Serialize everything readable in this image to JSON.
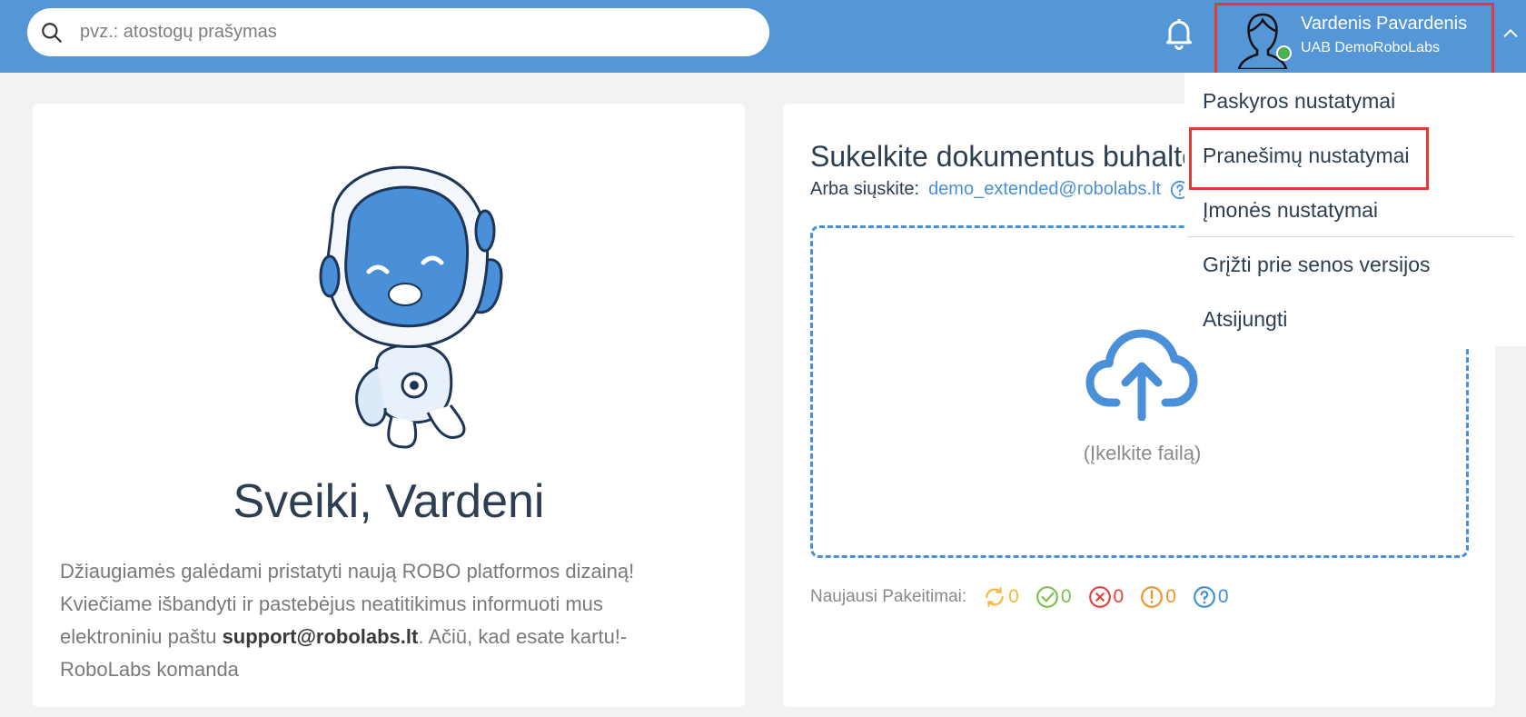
{
  "search": {
    "placeholder": "pvz.: atostogų prašymas"
  },
  "user": {
    "name": "Vardenis Pavardenis",
    "company": "UAB DemoRoboLabs",
    "status": "online"
  },
  "menu": {
    "items": [
      {
        "label": "Paskyros nustatymai"
      },
      {
        "label": "Pranešimų nustatymai",
        "highlighted": true
      },
      {
        "label": "Įmonės nustatymai"
      },
      {
        "label": "Grįžti prie senos versijos"
      },
      {
        "label": "Atsijungti"
      }
    ]
  },
  "welcome": {
    "title": "Sveiki, Vardeni",
    "text_1": "Džiaugiamės galėdami pristatyti naują ROBO platformos dizainą! Kviečiame išbandyti ir pastebėjus neatitikimus informuoti mus elektroniniu paštu ",
    "email": "support@robolabs.lt",
    "text_2": ". Ačiū, kad esate kartu!- RoboLabs komanda"
  },
  "upload": {
    "title": "Sukelkite dokumentus buhalte",
    "send_label": "Arba siųskite:",
    "send_email": "demo_extended@robolabs.lt",
    "drop_label": "(Įkelkite failą)",
    "changes_label": "Naujausi Pakeitimai:",
    "stats": [
      {
        "icon": "sync-icon",
        "value": "0",
        "color": "#f5b942"
      },
      {
        "icon": "check-circle-icon",
        "value": "0",
        "color": "#7cc04b"
      },
      {
        "icon": "x-circle-icon",
        "value": "0",
        "color": "#e5413c"
      },
      {
        "icon": "exclamation-circle-icon",
        "value": "0",
        "color": "#f0932b"
      },
      {
        "icon": "question-circle-icon",
        "value": "0",
        "color": "#3f8fd6"
      }
    ]
  },
  "colors": {
    "header": "#5596d6",
    "accent": "#4a90d9",
    "highlight": "#e53935"
  }
}
